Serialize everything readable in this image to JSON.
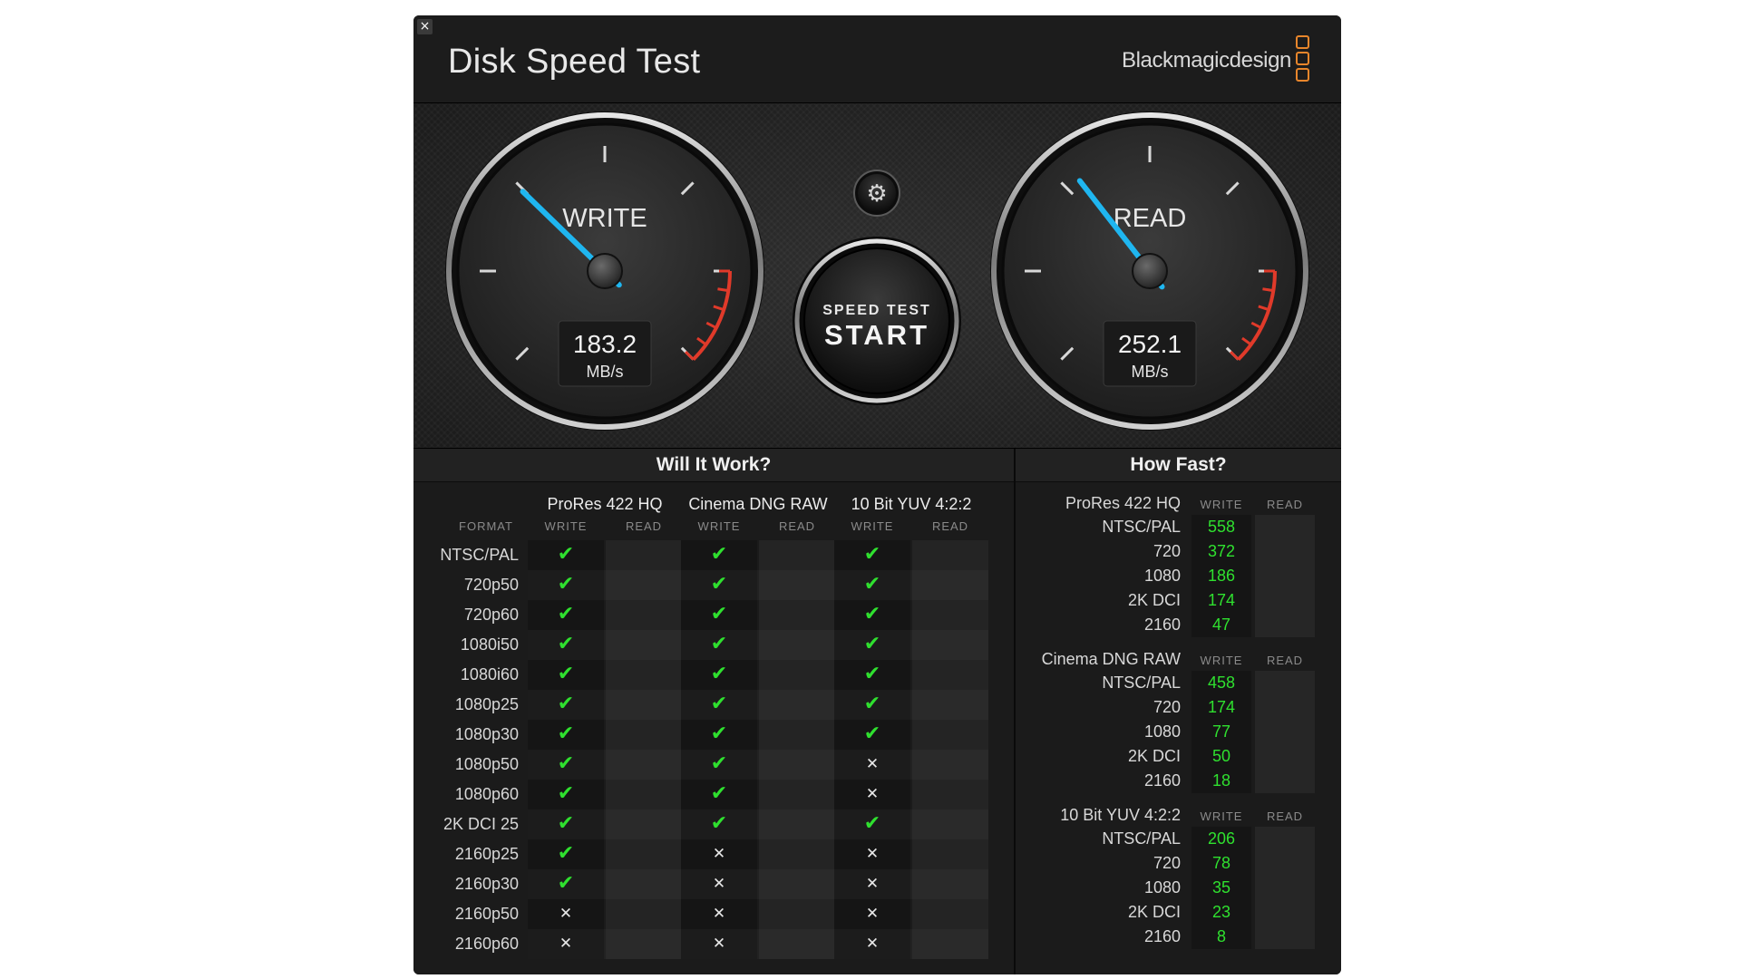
{
  "window": {
    "title": "Disk Speed Test",
    "brand": "Blackmagicdesign",
    "close_icon": "×"
  },
  "write_gauge": {
    "label": "WRITE",
    "value": "183.2",
    "unit": "MB/s",
    "needle_fraction": 0.33
  },
  "read_gauge": {
    "label": "READ",
    "value": "252.1",
    "unit": "MB/s",
    "needle_fraction": 0.36
  },
  "settings": {
    "icon": "⚙"
  },
  "start_button": {
    "line1": "SPEED TEST",
    "line2": "START"
  },
  "will_it_work": {
    "title": "Will It Work?",
    "format_header": "FORMAT",
    "write_label": "WRITE",
    "read_label": "READ",
    "codecs": [
      "ProRes 422 HQ",
      "Cinema DNG RAW",
      "10 Bit YUV 4:2:2"
    ],
    "rows": [
      {
        "format": "NTSC/PAL",
        "write": [
          "yes",
          "yes",
          "yes"
        ]
      },
      {
        "format": "720p50",
        "write": [
          "yes",
          "yes",
          "yes"
        ]
      },
      {
        "format": "720p60",
        "write": [
          "yes",
          "yes",
          "yes"
        ]
      },
      {
        "format": "1080i50",
        "write": [
          "yes",
          "yes",
          "yes"
        ]
      },
      {
        "format": "1080i60",
        "write": [
          "yes",
          "yes",
          "yes"
        ]
      },
      {
        "format": "1080p25",
        "write": [
          "yes",
          "yes",
          "yes"
        ]
      },
      {
        "format": "1080p30",
        "write": [
          "yes",
          "yes",
          "yes"
        ]
      },
      {
        "format": "1080p50",
        "write": [
          "yes",
          "yes",
          "no"
        ]
      },
      {
        "format": "1080p60",
        "write": [
          "yes",
          "yes",
          "no"
        ]
      },
      {
        "format": "2K DCI 25",
        "write": [
          "yes",
          "yes",
          "yes"
        ]
      },
      {
        "format": "2160p25",
        "write": [
          "yes",
          "no",
          "no"
        ]
      },
      {
        "format": "2160p30",
        "write": [
          "yes",
          "no",
          "no"
        ]
      },
      {
        "format": "2160p50",
        "write": [
          "no",
          "no",
          "no"
        ]
      },
      {
        "format": "2160p60",
        "write": [
          "no",
          "no",
          "no"
        ]
      }
    ]
  },
  "how_fast": {
    "title": "How Fast?",
    "write_label": "WRITE",
    "read_label": "READ",
    "groups": [
      {
        "name": "ProRes 422 HQ",
        "rows": [
          {
            "format": "NTSC/PAL",
            "write": "558"
          },
          {
            "format": "720",
            "write": "372"
          },
          {
            "format": "1080",
            "write": "186"
          },
          {
            "format": "2K DCI",
            "write": "174"
          },
          {
            "format": "2160",
            "write": "47"
          }
        ]
      },
      {
        "name": "Cinema DNG RAW",
        "rows": [
          {
            "format": "NTSC/PAL",
            "write": "458"
          },
          {
            "format": "720",
            "write": "174"
          },
          {
            "format": "1080",
            "write": "77"
          },
          {
            "format": "2K DCI",
            "write": "50"
          },
          {
            "format": "2160",
            "write": "18"
          }
        ]
      },
      {
        "name": "10 Bit YUV 4:2:2",
        "rows": [
          {
            "format": "NTSC/PAL",
            "write": "206"
          },
          {
            "format": "720",
            "write": "78"
          },
          {
            "format": "1080",
            "write": "35"
          },
          {
            "format": "2K DCI",
            "write": "23"
          },
          {
            "format": "2160",
            "write": "8"
          }
        ]
      }
    ]
  },
  "colors": {
    "accent_needle": "#1fb6f0",
    "ok": "#2fe02f",
    "redline": "#e03a2a",
    "logo": "#e8862b"
  }
}
